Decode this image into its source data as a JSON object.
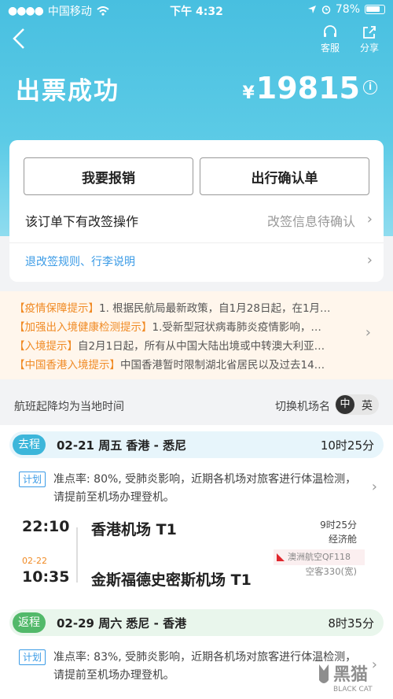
{
  "status_bar": {
    "carrier": "中国移动",
    "time": "下午 4:32",
    "battery": "78%"
  },
  "nav": {
    "service_label": "客服",
    "share_label": "分享"
  },
  "header": {
    "title": "出票成功",
    "currency": "¥",
    "price": "19815"
  },
  "actions": {
    "reimburse_label": "我要报销",
    "confirm_label": "出行确认单",
    "change_label": "该订单下有改签操作",
    "change_status": "改签信息待确认",
    "rules_label": "退改签规则、行李说明"
  },
  "notices": [
    {
      "tag": "【疫情保障提示】",
      "text": "1. 根据民航局最新政策，自1月28日起，在1月…"
    },
    {
      "tag": "【加强出入境健康检测提示】",
      "text": "1.受新型冠状病毒肺炎疫情影响，…"
    },
    {
      "tag": "【入境提示】",
      "text": "自2月1日起，所有从中国大陆出境或中转澳大利亚…"
    },
    {
      "tag": "【中国香港入境提示】",
      "text": "中国香港暂时限制湖北省居民以及过去14…"
    }
  ],
  "time_note": "航班起降均为当地时间",
  "switch": {
    "label": "切换机场名",
    "zh": "中",
    "en": "英"
  },
  "legs": [
    {
      "tag": "去程",
      "summary": "02-21  周五  香港 - 悉尼",
      "duration": "10时25分",
      "plan_tag": "计划",
      "note": "准点率: 80%, 受肺炎影响，近期各机场对旅客进行体温检测，请提前至机场办理登机。",
      "dep_time": "22:10",
      "arr_date": "02-22",
      "arr_time": "10:35",
      "dep_airport": "香港机场 T1",
      "arr_airport": "金斯福德史密斯机场 T1",
      "flight_duration": "9时25分",
      "cabin": "经济舱",
      "airline": "澳洲航空QF118",
      "aircraft": "空客330(宽)"
    },
    {
      "tag": "返程",
      "summary": "02-29  周六  悉尼 - 香港",
      "duration": "8时35分",
      "plan_tag": "计划",
      "note": "准点率: 83%, 受肺炎影响，近期各机场对旅客进行体温检测，请提前至机场办理登机。"
    }
  ],
  "colors": {
    "header": "#48bfe0",
    "outbound_tag": "#3cb6da",
    "return_tag": "#52b96a",
    "notice_orange": "#f08a24",
    "link_blue": "#3b9be6"
  },
  "watermark": {
    "text": "黑猫",
    "sub": "BLACK CAT"
  }
}
